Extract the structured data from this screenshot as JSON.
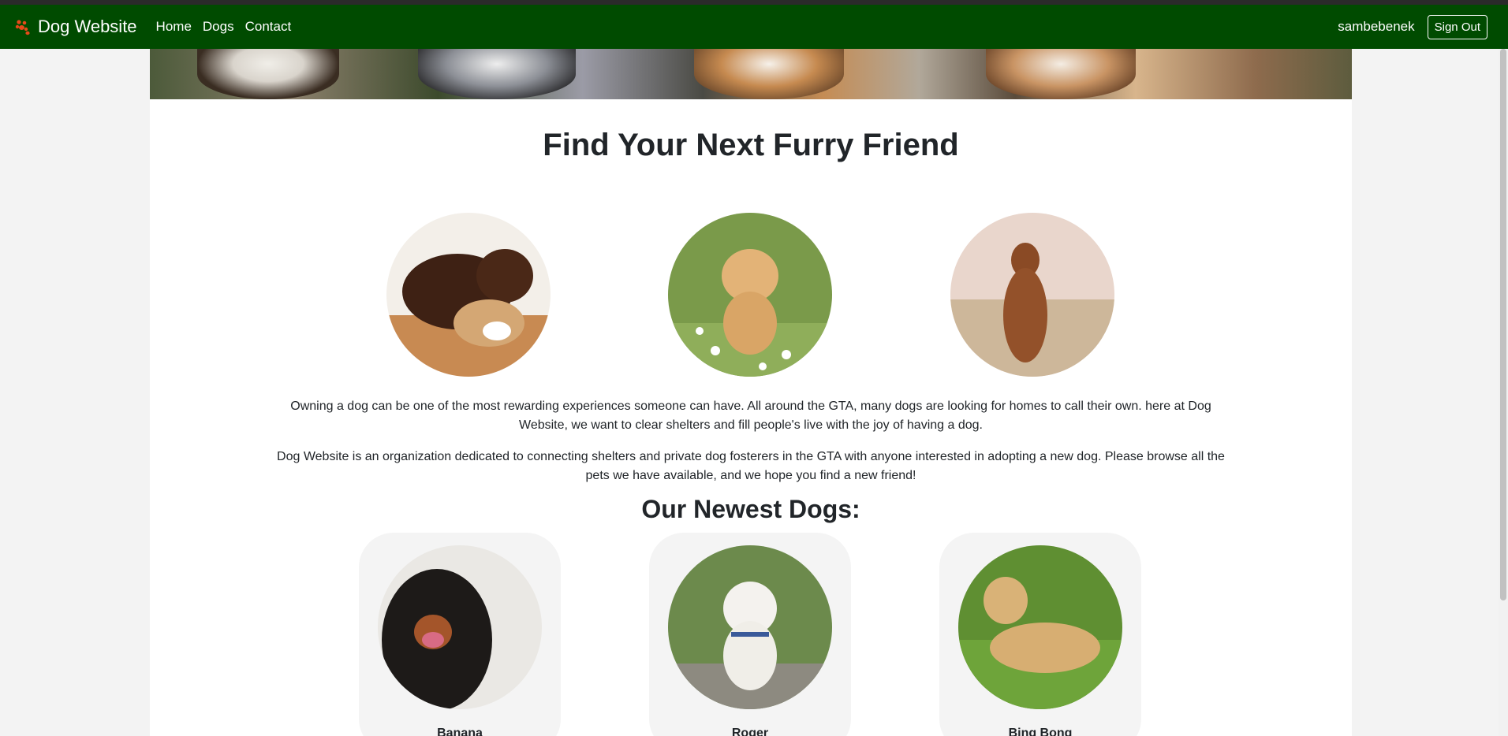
{
  "navbar": {
    "brand": "Dog Website",
    "links": [
      "Home",
      "Dogs",
      "Contact"
    ],
    "username": "sambebenek",
    "sign_out": "Sign Out"
  },
  "main": {
    "headline": "Find Your Next Furry Friend",
    "paragraph_1": "Owning a dog can be one of the most rewarding experiences someone can have. All around the GTA, many dogs are looking for homes to call their own. here at Dog Website, we want to clear shelters and fill people's live with the joy of having a dog.",
    "paragraph_2": "Dog Website is an organization dedicated to connecting shelters and private dog fosterers in the GTA with anyone interested in adopting a new dog. Please browse all the pets we have available, and we hope you find a new friend!",
    "newest_title": "Our Newest Dogs:",
    "newest_dogs": [
      {
        "name": "Banana"
      },
      {
        "name": "Roger"
      },
      {
        "name": "Bing Bong"
      }
    ]
  },
  "colors": {
    "navbar_bg": "#004b00",
    "card_bg": "#f4f4f4"
  }
}
